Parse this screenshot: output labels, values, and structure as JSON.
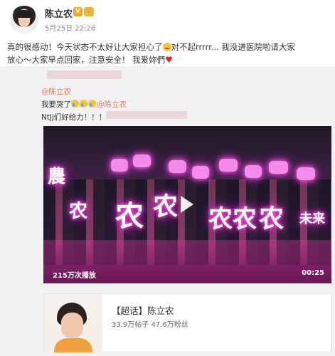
{
  "post": {
    "username": "陈立农",
    "verified_badge": "V",
    "member_badge": "👑",
    "time": "5月25日 22:26",
    "text_1": "真的很感动！今天状态不太好让大家担心了",
    "text_2": "对不起rrrrr... 我没进医院啦请大家",
    "text_3": "放心～大家早点回家，注意安全！ 我爱妳們",
    "heart": "♥"
  },
  "repost": {
    "user": "@陈立农",
    "line1_prefix": "我要哭了",
    "line1_mention": "@陈立农",
    "line2": "Ntjj们好给力！！！"
  },
  "video": {
    "play_count": "215万次播放",
    "duration": "00:25"
  },
  "topic_card": {
    "title": "【超话】陈立农",
    "stats": "33.9万帖子 47.6万粉丝"
  }
}
